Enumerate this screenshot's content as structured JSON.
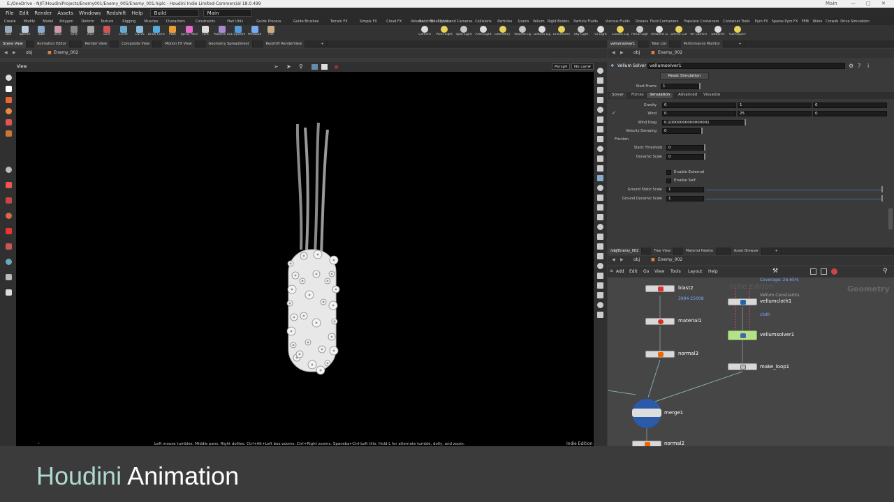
{
  "window": {
    "title": "E:/OneDrive - NJIT/HoudiniProjects/Enemy001/Enemy_005/Enemy_001.hiplc - Houdini Indie Limited-Commercial 18.0.499",
    "desktop_label": "Main"
  },
  "menubar": {
    "items": [
      "File",
      "Edit",
      "Render",
      "Assets",
      "Windows",
      "Redshift",
      "Help"
    ],
    "build": "Build",
    "desktop": "Main"
  },
  "shelf": {
    "tabs_left": [
      "Create",
      "Modify",
      "Model",
      "Polygon",
      "Deform",
      "Texture",
      "Rigging",
      "Muscles",
      "Characters",
      "Constraints",
      "Hair Utils",
      "Guide Process",
      "Guide Brushes",
      "Terrain FX",
      "Simple FX",
      "Cloud FX",
      "Volume",
      "SideFX Labs"
    ],
    "tabs_right": [
      "Redshift",
      "Lights and Cameras",
      "Collisions",
      "Particles",
      "Grains",
      "Vellum",
      "Rigid Bodies",
      "Particle Fluids",
      "Viscous Fluids",
      "Oceans",
      "Fluid Containers",
      "Populate Containers",
      "Container Tools",
      "Pyro FX",
      "Sparse Pyro FX",
      "FEM",
      "Wires",
      "Crowds",
      "Drive Simulation"
    ],
    "tools_left": [
      "Box",
      "Sphere",
      "Tube",
      "Torus",
      "Grid",
      "Null",
      "Line",
      "Circle",
      "Curve",
      "Draw Curve",
      "Path",
      "Spray Paint",
      "Font",
      "Platonic Solids",
      "L-System",
      "Metaball",
      "File"
    ],
    "tools_right": [
      "Camera",
      "Point Light",
      "Spot Light",
      "Area Light",
      "Geometry Light",
      "Volume Light",
      "Distant Light",
      "Environment Light",
      "Sky Light",
      "GI Light",
      "Caustic Light",
      "Portal Light",
      "Ambient Light",
      "Stereo Camera",
      "VR Camera",
      "Switcher",
      "Gamepad Camera"
    ]
  },
  "left_pane": {
    "tabs": [
      "Scene View",
      "Animation Editor",
      "Render View",
      "Composite View",
      "Motion FX View",
      "Geometry Spreadsheet",
      "Redshift RenderView"
    ],
    "path": [
      "obj",
      "Enemy_002"
    ],
    "view_label": "View",
    "persp": "Persp",
    "cam": "No cam",
    "status_hint": "Left mouse tumbles. Middle pans. Right dollies. Ctrl+Alt+Left box-zooms. Ctrl+Right zooms. Spacebar-Ctrl-Left tilts. Hold L for alternate tumble, dolly, and zoom.",
    "edition": "Indie Edition"
  },
  "param_pane": {
    "tabs": [
      "vellumsolver1",
      "Take List",
      "Performance Monitor"
    ],
    "path": [
      "obj",
      "Enemy_002"
    ],
    "node_type": "Vellum Solver",
    "node_name": "vellumsolver1",
    "reset_button": "Reset Simulation",
    "start_frame_label": "Start Frame",
    "start_frame": "1",
    "subtabs": [
      "Solver",
      "Forces",
      "Simulation",
      "Advanced",
      "Visualize"
    ],
    "gravity_label": "Gravity",
    "gravity": [
      "0",
      "1",
      "0"
    ],
    "wind_label": "Wind",
    "wind": [
      "0",
      "25",
      "0"
    ],
    "wind_drag_label": "Wind Drag",
    "wind_drag": "0.10000000000000001",
    "velocity_damping_label": "Velocity Damping",
    "velocity_damping": "0",
    "friction_label": "Friction",
    "static_threshold_label": "Static Threshold",
    "static_threshold": "0",
    "dynamic_scale_label": "Dynamic Scale",
    "dynamic_scale": "0",
    "enable_external": "Enable External",
    "enable_self": "Enable Self",
    "ground_static_label": "Ground Static Scale",
    "ground_static": "1",
    "ground_dynamic_label": "Ground Dynamic Scale",
    "ground_dynamic": "1"
  },
  "network_pane": {
    "tabs": [
      "/obj/Enemy_002",
      "Tree View",
      "Material Palette",
      "Asset Browser"
    ],
    "path": [
      "obj",
      "Enemy_002"
    ],
    "menu": [
      "Add",
      "Edit",
      "Go",
      "View",
      "Tools",
      "Layout",
      "Help"
    ],
    "watermark": "Indie Edition",
    "context": "Geometry",
    "coverage": "Coverage: 26.65%",
    "nodes": {
      "blast2": "blast2",
      "blast2_sub": "3994-25008",
      "material1": "material1",
      "normal3": "normal3",
      "vellum_constraints": "Vellum Constraints",
      "vellumcloth1": "vellumcloth1",
      "cloth": "cloth",
      "vellumsolver1": "vellumsolver1",
      "make_loop1": "make_loop1",
      "merge1": "merge1",
      "normal2": "normal2"
    }
  },
  "caption": {
    "part1": "Houdini",
    "part2": "Animation"
  }
}
